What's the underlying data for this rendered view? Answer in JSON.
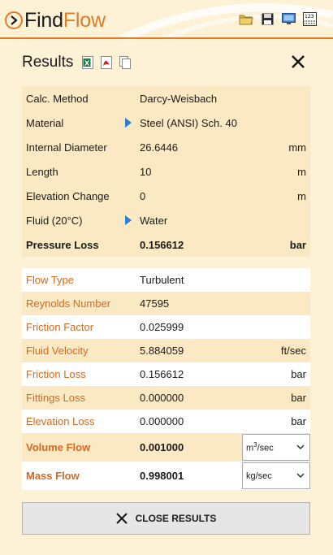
{
  "app": {
    "name_part1": "Find",
    "name_part2": "Flow",
    "accent_color": "#e07b2a",
    "toolbar_icons": [
      "open-folder-icon",
      "save-icon",
      "screen-capture-icon",
      "calculator-icon"
    ]
  },
  "results": {
    "title": "Results",
    "export_icons": [
      "excel-icon",
      "pdf-icon",
      "copy-icon"
    ],
    "inputs": [
      {
        "label": "Calc. Method",
        "value": "Darcy-Weisbach",
        "unit": "",
        "selectable": false
      },
      {
        "label": "Material",
        "value": "Steel (ANSI) Sch.  40",
        "unit": "",
        "selectable": true
      },
      {
        "label": "Internal Diameter",
        "value": "26.6446",
        "unit": "mm",
        "selectable": false
      },
      {
        "label": "Length",
        "value": "10",
        "unit": "m",
        "selectable": false
      },
      {
        "label": "Elevation Change",
        "value": "0",
        "unit": "m",
        "selectable": false
      },
      {
        "label": "Fluid (20°C)",
        "value": "Water",
        "unit": "",
        "selectable": true
      },
      {
        "label": "Pressure Loss",
        "value": "0.156612",
        "unit": "bar",
        "selectable": false
      }
    ],
    "outputs": [
      {
        "label": "Flow Type",
        "value": "Turbulent",
        "unit": ""
      },
      {
        "label": "Reynolds Number",
        "value": "47595",
        "unit": ""
      },
      {
        "label": "Friction Factor",
        "value": "0.025999",
        "unit": ""
      },
      {
        "label": "Fluid Velocity",
        "value": "5.884059",
        "unit": "ft/sec"
      },
      {
        "label": "Friction Loss",
        "value": "0.156612",
        "unit": "bar"
      },
      {
        "label": "Fittings Loss",
        "value": "0.000000",
        "unit": "bar"
      },
      {
        "label": "Elevation Loss",
        "value": "0.000000",
        "unit": "bar"
      }
    ],
    "volume_flow": {
      "label": "Volume Flow",
      "value": "0.001000",
      "unit_main": "m",
      "unit_sup": "3",
      "unit_rest": "/sec"
    },
    "mass_flow": {
      "label": "Mass Flow",
      "value": "0.998001",
      "unit": "kg/sec"
    },
    "close_button": "CLOSE RESULTS"
  }
}
